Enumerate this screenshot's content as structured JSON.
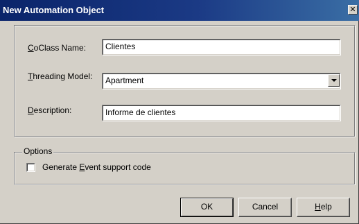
{
  "window": {
    "title": "New Automation Object",
    "close_glyph": "✕"
  },
  "form": {
    "coclass": {
      "label_accel": "C",
      "label_rest": "oClass Name:",
      "value": "Clientes"
    },
    "threading": {
      "label_accel": "T",
      "label_rest": "hreading Model:",
      "value": "Apartment"
    },
    "description": {
      "label_accel": "D",
      "label_rest": "escription:",
      "value": "Informe de clientes"
    }
  },
  "options": {
    "legend": "Options",
    "generate_event": {
      "label_pre": "Generate ",
      "label_accel": "E",
      "label_post": "vent support code",
      "checked": false
    }
  },
  "buttons": {
    "ok": "OK",
    "cancel": "Cancel",
    "help_accel": "H",
    "help_rest": "elp"
  },
  "icons": {
    "close": "close-icon",
    "dropdown": "chevron-down-icon"
  }
}
